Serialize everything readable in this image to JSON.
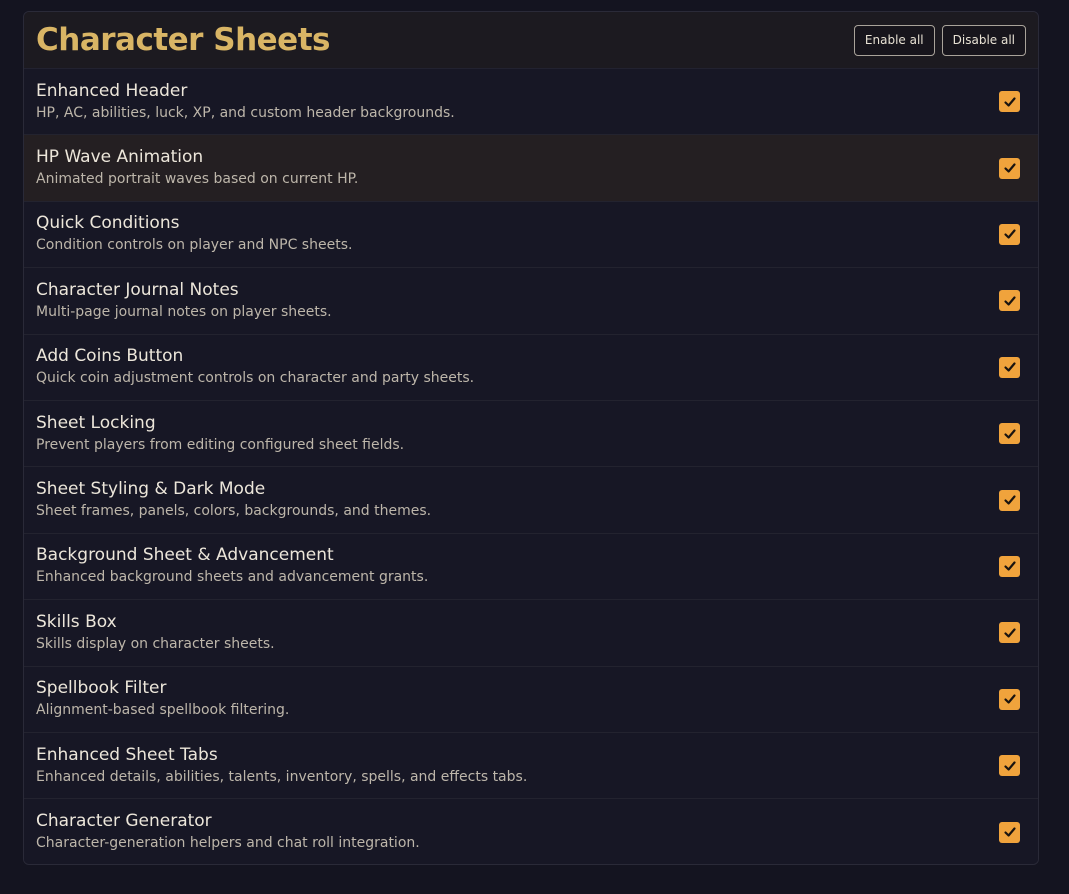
{
  "header": {
    "title": "Character Sheets",
    "enable_all": "Enable all",
    "disable_all": "Disable all"
  },
  "colors": {
    "accent": "#f0a33c",
    "title": "#d9b565"
  },
  "items": [
    {
      "name": "Enhanced Header",
      "description": "HP, AC, abilities, luck, XP, and custom header backgrounds.",
      "enabled": true
    },
    {
      "name": "HP Wave Animation",
      "description": "Animated portrait waves based on current HP.",
      "enabled": true
    },
    {
      "name": "Quick Conditions",
      "description": "Condition controls on player and NPC sheets.",
      "enabled": true
    },
    {
      "name": "Character Journal Notes",
      "description": "Multi-page journal notes on player sheets.",
      "enabled": true
    },
    {
      "name": "Add Coins Button",
      "description": "Quick coin adjustment controls on character and party sheets.",
      "enabled": true
    },
    {
      "name": "Sheet Locking",
      "description": "Prevent players from editing configured sheet fields.",
      "enabled": true
    },
    {
      "name": "Sheet Styling & Dark Mode",
      "description": "Sheet frames, panels, colors, backgrounds, and themes.",
      "enabled": true
    },
    {
      "name": "Background Sheet & Advancement",
      "description": "Enhanced background sheets and advancement grants.",
      "enabled": true
    },
    {
      "name": "Skills Box",
      "description": "Skills display on character sheets.",
      "enabled": true
    },
    {
      "name": "Spellbook Filter",
      "description": "Alignment-based spellbook filtering.",
      "enabled": true
    },
    {
      "name": "Enhanced Sheet Tabs",
      "description": "Enhanced details, abilities, talents, inventory, spells, and effects tabs.",
      "enabled": true
    },
    {
      "name": "Character Generator",
      "description": "Character-generation helpers and chat roll integration.",
      "enabled": true
    }
  ]
}
